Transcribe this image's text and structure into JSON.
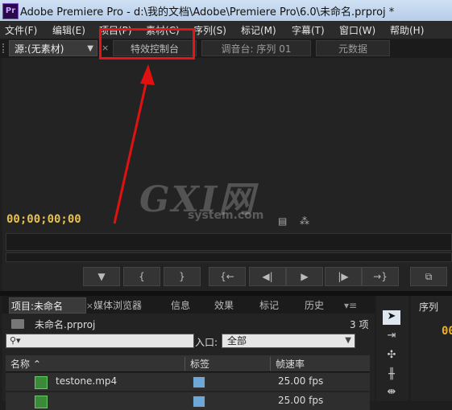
{
  "window": {
    "logo": "Pr",
    "title": "Adobe Premiere Pro - d:\\我的文档\\Adobe\\Premiere Pro\\6.0\\未命名.prproj *"
  },
  "menu": {
    "items": [
      "文件(F)",
      "编辑(E)",
      "项目(P)",
      "素材(C)",
      "序列(S)",
      "标记(M)",
      "字幕(T)",
      "窗口(W)",
      "帮助(H)"
    ]
  },
  "source_panel": {
    "tabs": {
      "source": "源:(无素材)",
      "effect_controls": "特效控制台",
      "audio_mixer": "调音台: 序列 01",
      "metadata": "元数据"
    },
    "timecode": "00;00;00;00",
    "watermark": "GXI网",
    "watermark_sub": "system.com"
  },
  "project_panel": {
    "tabs": {
      "project": "项目:未命名",
      "media_browser": "媒体浏览器",
      "info": "信息",
      "effects": "效果",
      "markers": "标记",
      "history": "历史"
    },
    "project_name": "未命名.prproj",
    "item_count": "3 项",
    "search_placeholder": "",
    "in_label": "入口:",
    "in_value": "全部",
    "columns": {
      "name": "名称",
      "label": "标签",
      "frame_rate": "帧速率"
    },
    "rows": [
      {
        "name": "testone.mp4",
        "frame_rate": "25.00 fps",
        "label_color": "#6ea8d8"
      },
      {
        "name": "",
        "frame_rate": "25.00 fps",
        "label_color": "#6ea8d8"
      }
    ]
  },
  "sequence_panel": {
    "label": "序列",
    "timecode": "00"
  },
  "colors": {
    "annotation_red": "#e11111",
    "timecode": "#e8c050"
  }
}
